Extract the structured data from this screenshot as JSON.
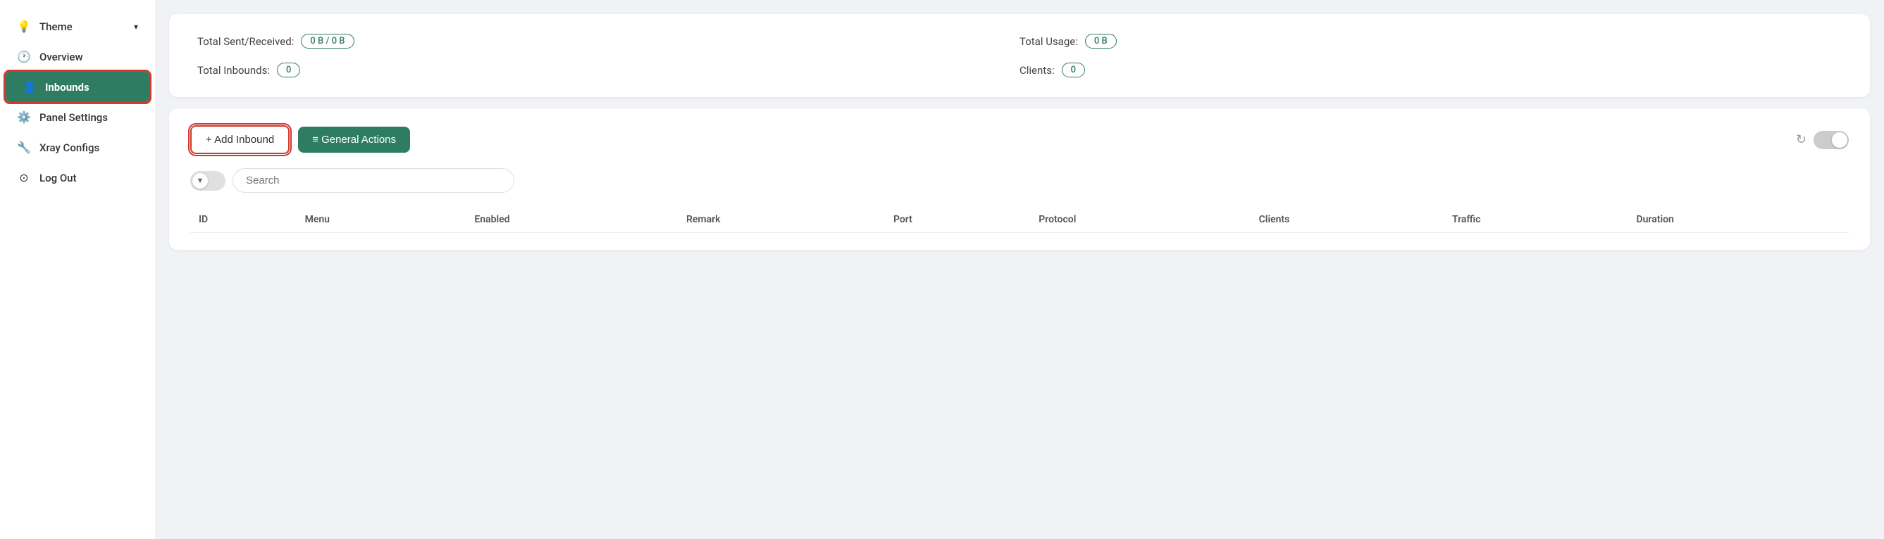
{
  "sidebar": {
    "items": [
      {
        "id": "theme",
        "label": "Theme",
        "icon": "💡",
        "active": false,
        "hasChevron": true
      },
      {
        "id": "overview",
        "label": "Overview",
        "icon": "🕐",
        "active": false,
        "hasChevron": false
      },
      {
        "id": "inbounds",
        "label": "Inbounds",
        "icon": "👤",
        "active": true,
        "hasChevron": false
      },
      {
        "id": "panel-settings",
        "label": "Panel Settings",
        "icon": "⚙️",
        "active": false,
        "hasChevron": false
      },
      {
        "id": "xray-configs",
        "label": "Xray Configs",
        "icon": "🔧",
        "active": false,
        "hasChevron": false
      },
      {
        "id": "log-out",
        "label": "Log Out",
        "icon": "⊙",
        "active": false,
        "hasChevron": false
      }
    ]
  },
  "stats": {
    "total_sent_received_label": "Total Sent/Received:",
    "total_sent_received_value": "0 B / 0 B",
    "total_usage_label": "Total Usage:",
    "total_usage_value": "0 B",
    "total_inbounds_label": "Total Inbounds:",
    "total_inbounds_value": "0",
    "clients_label": "Clients:",
    "clients_value": "0"
  },
  "toolbar": {
    "add_inbound_label": "+ Add Inbound",
    "general_actions_label": "≡ General Actions",
    "refresh_icon": "↻",
    "toggle_state": false
  },
  "search": {
    "placeholder": "Search",
    "filter_icon": "▼"
  },
  "table": {
    "columns": [
      "ID",
      "Menu",
      "Enabled",
      "Remark",
      "Port",
      "Protocol",
      "Clients",
      "Traffic",
      "Duration"
    ],
    "rows": []
  }
}
